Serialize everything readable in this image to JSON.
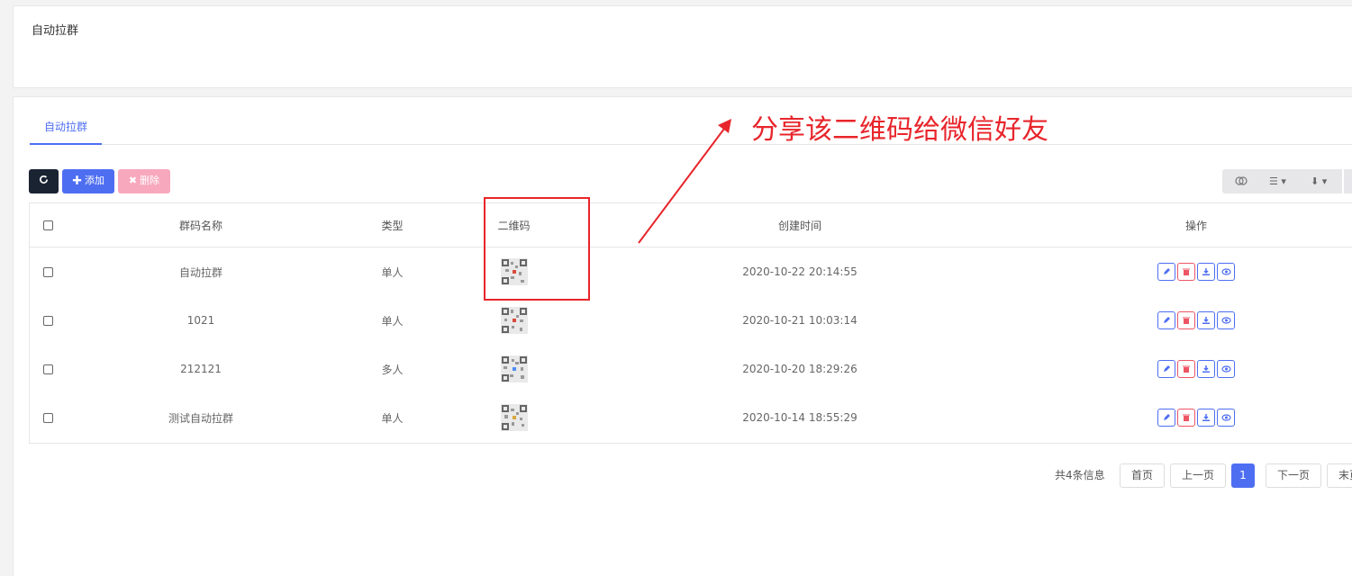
{
  "page_title": "自动拉群",
  "tabs": [
    {
      "label": "自动拉群"
    }
  ],
  "toolbar": {
    "add_label": "添加",
    "delete_label": "删除"
  },
  "table": {
    "columns": [
      "群码名称",
      "类型",
      "二维码",
      "创建时间",
      "操作"
    ],
    "rows": [
      {
        "name": "自动拉群",
        "type": "单人",
        "created": "2020-10-22 20:14:55"
      },
      {
        "name": "1021",
        "type": "单人",
        "created": "2020-10-21 10:03:14"
      },
      {
        "name": "212121",
        "type": "多人",
        "created": "2020-10-20 18:29:26"
      },
      {
        "name": "测试自动拉群",
        "type": "单人",
        "created": "2020-10-14 18:55:29"
      }
    ]
  },
  "pagination": {
    "summary": "共4条信息",
    "first": "首页",
    "prev": "上一页",
    "current": "1",
    "next": "下一页",
    "last": "末页"
  },
  "annotation": {
    "text": "分享该二维码给微信好友",
    "color": "#e8252b"
  },
  "colors": {
    "primary": "#4e6ef2",
    "danger": "#ed5565",
    "dark": "#1a2332"
  }
}
